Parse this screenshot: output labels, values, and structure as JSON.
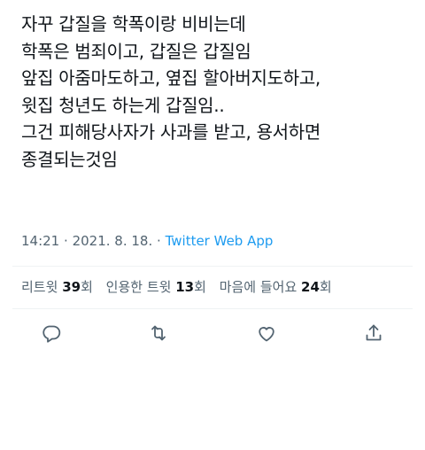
{
  "tweet": {
    "lines": [
      "자꾸 갑질을 학폭이랑 비비는데",
      "학폭은 범죄이고, 갑질은 갑질임",
      "앞집 아줌마도하고, 옆집 할아버지도하고,",
      "윗집 청년도 하는게 갑질임..",
      "그건 피해당사자가 사과를 받고, 용서하면",
      "종결되는것임"
    ]
  },
  "meta": {
    "time": "14:21",
    "separator": "·",
    "date": "2021. 8. 18.",
    "source": "Twitter Web App"
  },
  "stats": {
    "retweets": {
      "label": "리트윗",
      "count": "39",
      "unit": "회"
    },
    "quotes": {
      "label": "인용한 트윗",
      "count": "13",
      "unit": "회"
    },
    "likes": {
      "label": "마음에 들어요",
      "count": "24",
      "unit": "회"
    }
  },
  "actions": {
    "icons": [
      "reply-icon",
      "retweet-icon",
      "like-icon",
      "share-icon"
    ]
  }
}
